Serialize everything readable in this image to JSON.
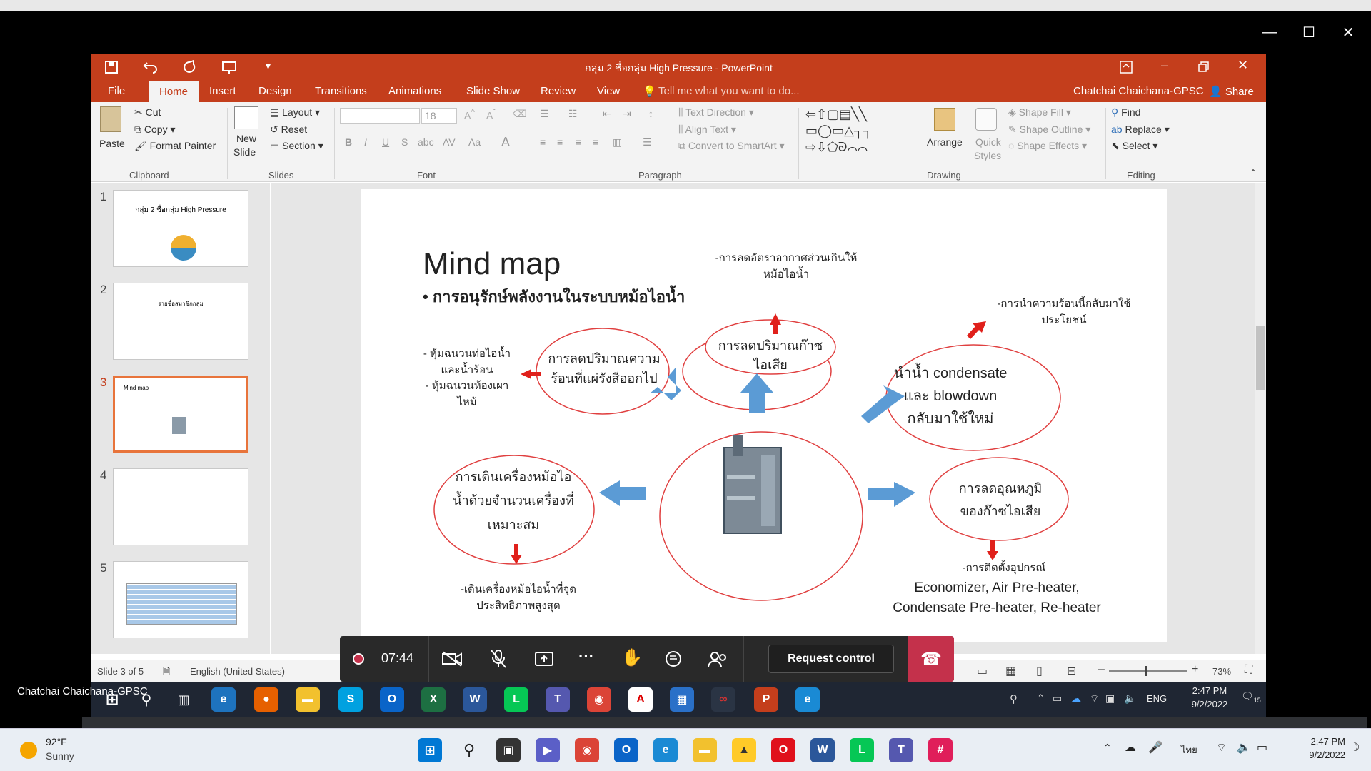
{
  "outer": {
    "minimize": "—",
    "maximize": "☐",
    "close": "✕"
  },
  "ppt": {
    "window_title": "กลุ่ม 2 ชื่อกลุ่ม High Pressure - PowerPoint",
    "user": "Chatchai Chaichana-GPSC",
    "share": "Share",
    "tabs": [
      "File",
      "Home",
      "Insert",
      "Design",
      "Transitions",
      "Animations",
      "Slide Show",
      "Review",
      "View"
    ],
    "tell_me": "Tell me what you want to do...",
    "ribbon": {
      "paste": "Paste",
      "cut": "Cut",
      "copy": "Copy",
      "format_painter": "Format Painter",
      "clipboard": "Clipboard",
      "new_slide": "New",
      "new_slide2": "Slide",
      "layout": "Layout",
      "reset": "Reset",
      "section": "Section",
      "slides": "Slides",
      "font_size": "18",
      "font": "Font",
      "text_direction": "Text Direction",
      "align_text": "Align Text",
      "convert_smartart": "Convert to SmartArt",
      "paragraph": "Paragraph",
      "arrange": "Arrange",
      "quick_styles": "Quick",
      "quick_styles2": "Styles",
      "shape_fill": "Shape Fill",
      "shape_outline": "Shape Outline",
      "shape_effects": "Shape Effects",
      "drawing": "Drawing",
      "find": "Find",
      "replace": "Replace",
      "select": "Select",
      "editing": "Editing"
    },
    "thumbnails": [
      {
        "num": "1",
        "title": "กลุ่ม 2 ชื่อกลุ่ม High Pressure"
      },
      {
        "num": "2",
        "title": "รายชื่อสมาชิกกลุ่ม"
      },
      {
        "num": "3",
        "title": "Mind map"
      },
      {
        "num": "4",
        "title": ""
      },
      {
        "num": "5",
        "title": ""
      }
    ],
    "status": {
      "slide": "Slide 3 of 5",
      "language": "English (United States)",
      "zoom": "73%"
    }
  },
  "slide": {
    "title": "Mind map",
    "bullet": "การอนุรักษ์พลังงานในระบบหม้อไอน้ำ",
    "top_note": "-การลดอัตราอากาศส่วนเกินให้\nหม้อไอน้ำ",
    "top_cloud": "การลดปริมาณก๊าซไอเสีย",
    "left_top_cloud": "การลดปริมาณความ\nร้อนที่แผ่รังสีออกไป",
    "left_note": "- หุ้มฉนวนท่อไอน้ำ\nและน้ำร้อน\n- หุ้มฉนวนห้องเผา\nไหม้",
    "right_top_note": "-การนำความร้อนนี้กลับมาใช้\nประโยชน์",
    "right_top_cloud": "นำน้ำ condensate\nและ blowdown\nกลับมาใช้ใหม่",
    "left_cloud": "การเดินเครื่องหม้อไอ\nน้ำด้วยจำนวนเครื่องที่\nเหมาะสม",
    "bottom_left_note": "-เดินเครื่องหม้อไอน้ำที่จุด\nประสิทธิภาพสูงสุด",
    "right_cloud": "การลดอุณหภูมิ\nของก๊าซไอเสีย",
    "bottom_right_note": "-การติดตั้งอุปกรณ์",
    "bottom_right_list": "Economizer, Air Pre-heater,\nCondensate Pre-heater, Re-heater"
  },
  "call": {
    "timer": "07:44",
    "request_control": "Request control"
  },
  "remote_taskbar": {
    "time": "2:47 PM",
    "date": "9/2/2022",
    "lang": "ENG",
    "presenter": "Chatchai Chaichana-GPSC",
    "notifications": "15"
  },
  "local_taskbar": {
    "weather_temp": "92°F",
    "weather_desc": "Sunny",
    "lang": "ไทย",
    "time": "2:47 PM",
    "date": "9/2/2022"
  },
  "colors": {
    "ppt_orange": "#c43e1c",
    "cloud_outline": "#e04040",
    "arrow_blue": "#5b9bd5",
    "arrow_red": "#e0201b"
  }
}
